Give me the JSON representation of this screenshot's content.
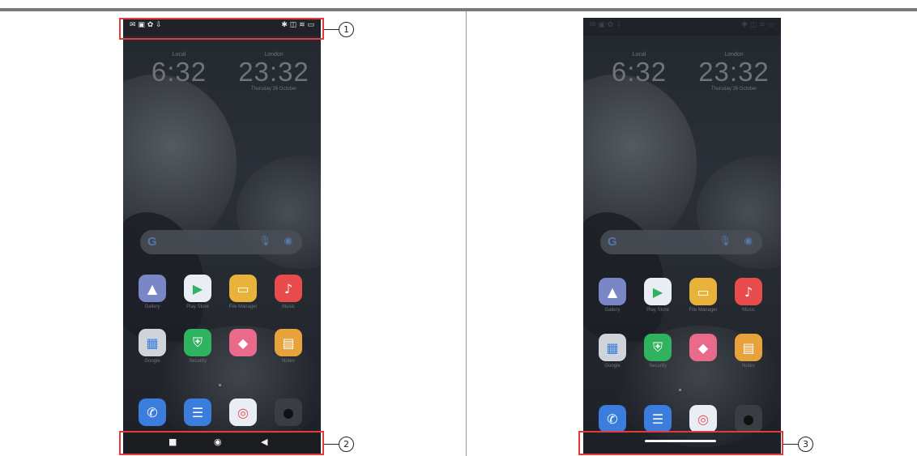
{
  "callouts": [
    "1",
    "2",
    "3"
  ],
  "phones": [
    {
      "status_left": "✉ ▣ ✿ ⇩",
      "status_right": "✱ ◫ ≋ ▭",
      "clock_local": {
        "label": "Local",
        "time": "6:32",
        "date": ""
      },
      "clock_london": {
        "label": "London",
        "time": "23:32",
        "date": "Thursday 26 October"
      },
      "apps": [
        "Gallery",
        "Play Store",
        "File Manager",
        "Music",
        "Google",
        "Security",
        "",
        "Notes"
      ],
      "nav": {
        "recent": "■",
        "home": "◉",
        "back": "◀"
      }
    },
    {
      "status_left": "✉ ▣ ✿ ⇩",
      "status_right": "✱ ◫ ≋ ▭",
      "clock_local": {
        "label": "Local",
        "time": "6:32",
        "date": ""
      },
      "clock_london": {
        "label": "London",
        "time": "23:32",
        "date": "Thursday 26 October"
      },
      "apps": [
        "Gallery",
        "Play Store",
        "File Manager",
        "Music",
        "Google",
        "Security",
        "",
        "Notes"
      ]
    }
  ],
  "app_icons": [
    "▲",
    "▶",
    "▭",
    "♪",
    "▦",
    "⛨",
    "◆",
    "▤"
  ],
  "dock_icons": [
    "✆",
    "☰",
    "◎",
    "●"
  ],
  "search": {
    "g": "G",
    "mic": "🎙",
    "lens": "◉"
  },
  "colors": {
    "highlight": "#e43a3a",
    "gallery": "#7b86c6",
    "play": "#e9eef5",
    "files": "#e8b23b",
    "music": "#e84b4b",
    "google": "#cfd4db",
    "security": "#2fb35e",
    "themes": "#ea6a8c",
    "notes": "#e8a23b",
    "phone_app": "#3b7ddd",
    "messages": "#3b7ddd",
    "chrome": "#e9eef5",
    "camera": "#3a3d44"
  }
}
